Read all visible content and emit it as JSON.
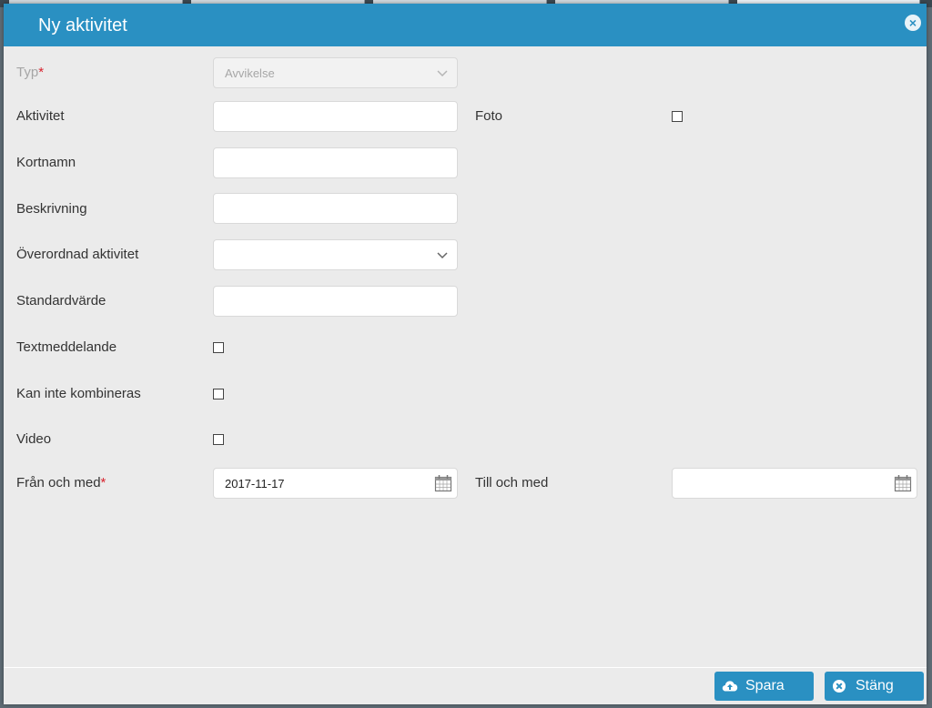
{
  "dialog": {
    "title": "Ny aktivitet",
    "fields": {
      "typ": {
        "label": "Typ",
        "required_mark": "*",
        "value": "Avvikelse"
      },
      "aktivitet": {
        "label": "Aktivitet",
        "value": ""
      },
      "foto": {
        "label": "Foto",
        "checked": false
      },
      "kortnamn": {
        "label": "Kortnamn",
        "value": ""
      },
      "beskrivning": {
        "label": "Beskrivning",
        "value": ""
      },
      "overordnad": {
        "label": "Överordnad aktivitet",
        "value": ""
      },
      "standardvarde": {
        "label": "Standardvärde",
        "value": ""
      },
      "textmeddelande": {
        "label": "Textmeddelande",
        "checked": false
      },
      "kan_inte_kombineras": {
        "label": "Kan inte kombineras",
        "checked": false
      },
      "video": {
        "label": "Video",
        "checked": false
      },
      "fran_och_med": {
        "label": "Från och med",
        "required_mark": "*",
        "value": "2017-11-17"
      },
      "till_och_med": {
        "label": "Till och med",
        "value": ""
      }
    },
    "buttons": {
      "save": {
        "label": "Spara",
        "icon": "cloud-upload-icon"
      },
      "close": {
        "label": "Stäng",
        "icon": "close-circle-icon"
      }
    }
  },
  "colors": {
    "header": "#2a90c2",
    "dialog_background": "#ebebeb",
    "required": "#d8242f"
  }
}
